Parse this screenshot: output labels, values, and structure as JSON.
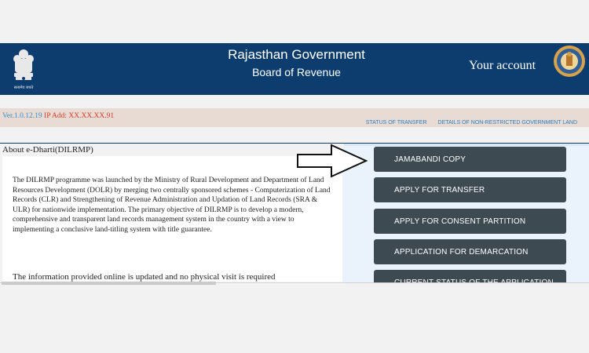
{
  "header": {
    "title": "Rajasthan Government",
    "subtitle": "Board of Revenue",
    "account_label": "Your account",
    "emblem_caption": "सत्यमेव जयते"
  },
  "strip": {
    "version_label": "Ver.1.0.12.19",
    "ip_label": "IP Add: XX.XX.XX.91",
    "links": [
      "STATUS OF TRANSFER",
      "DETAILS OF NON-RESTRICTED GOVERNMENT LAND"
    ]
  },
  "about": {
    "title": "About e-Dharti(DILRMP)",
    "paragraph1": "The DILRMP programme was launched by the Ministry of Rural Development and Department of Land Resources Development (DOLR) by merging two centrally sponsored schemes - Computerization of Land Records (CLR) and Strengthening of Revenue Administration and Updation of Land Records (SRA & ULR) for nationwide implementation. The primary objective of DILRMP is to develop a modern, comprehensive and transparent land records management system in the country with a view to implementing a conclusive land-titling system with title guarantee.",
    "paragraph2": "The information provided online is updated and no physical visit is required"
  },
  "services": [
    "JAMABANDI COPY",
    "APPLY FOR TRANSFER",
    "APPLY FOR CONSENT PARTITION",
    "APPLICATION FOR DEMARCATION",
    "CURRENT STATUS OF THE APPLICATION"
  ],
  "colors": {
    "header_bg": "#0d3d6f",
    "strip_bg": "#e7dbd3",
    "button_bg": "#3d4a52",
    "version_red": "#d43a2a",
    "link_blue": "#2a7ec0"
  }
}
